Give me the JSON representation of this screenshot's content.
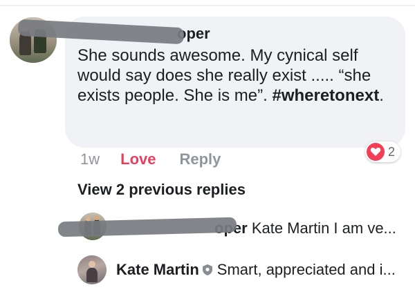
{
  "comment": {
    "author_visible": "oper",
    "text": "She sounds awesome. My cynical self would say does she really exist .....  “she exists people. She is me”. ",
    "hashtag": "#wheretonext",
    "text_end": ".",
    "timestamp": "1w",
    "reaction_link": "Love",
    "reply_label": "Reply",
    "reaction_count": "2",
    "reaction_type": "love-icon"
  },
  "view_previous": "View 2 previous replies",
  "replies": [
    {
      "author_visible": "oper",
      "text": "Kate Martin I am ve..."
    },
    {
      "author": "Kate Martin",
      "badge": "shield-badge-icon",
      "text": "Smart, appreciated and i..."
    }
  ],
  "colors": {
    "bubble": "#f0f2f5",
    "love": "#e4405f",
    "muted": "#90949c",
    "heart": "#f33e58",
    "redaction": "#777b80"
  }
}
